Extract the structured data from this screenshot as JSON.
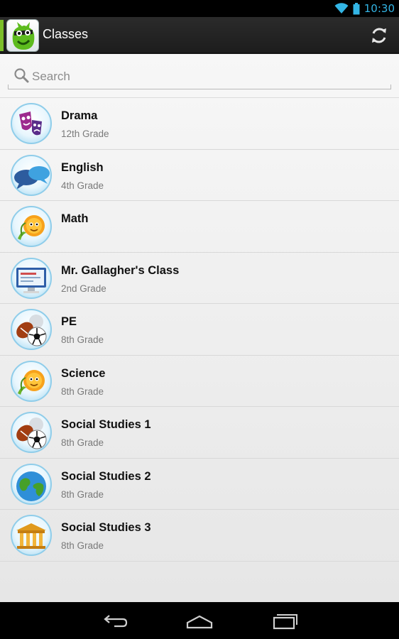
{
  "status_bar": {
    "time": "10:30"
  },
  "action_bar": {
    "title": "Classes",
    "icons": {
      "logo": "classdojo-monster-logo",
      "refresh": "refresh-icon"
    }
  },
  "search": {
    "placeholder": "Search",
    "value": ""
  },
  "classes": [
    {
      "name": "Drama",
      "grade": "12th Grade",
      "icon": "theater-masks-icon"
    },
    {
      "name": "English",
      "grade": "4th Grade",
      "icon": "speech-bubbles-icon"
    },
    {
      "name": "Math",
      "grade": "",
      "icon": "sun-character-icon"
    },
    {
      "name": "Mr. Gallagher's Class",
      "grade": "2nd Grade",
      "icon": "computer-monitor-icon"
    },
    {
      "name": "PE",
      "grade": "8th Grade",
      "icon": "sports-balls-icon"
    },
    {
      "name": "Science",
      "grade": "8th Grade",
      "icon": "sun-character-icon"
    },
    {
      "name": "Social Studies 1",
      "grade": "8th Grade",
      "icon": "sports-balls-icon"
    },
    {
      "name": "Social Studies 2",
      "grade": "8th Grade",
      "icon": "globe-icon"
    },
    {
      "name": "Social Studies 3",
      "grade": "8th Grade",
      "icon": "temple-icon"
    }
  ],
  "nav": {
    "back": "back-icon",
    "home": "home-icon",
    "recents": "recent-apps-icon"
  },
  "colors": {
    "status_accent": "#33b5e5",
    "action_bar": "#222222",
    "brand_green": "#7cbf2a"
  }
}
